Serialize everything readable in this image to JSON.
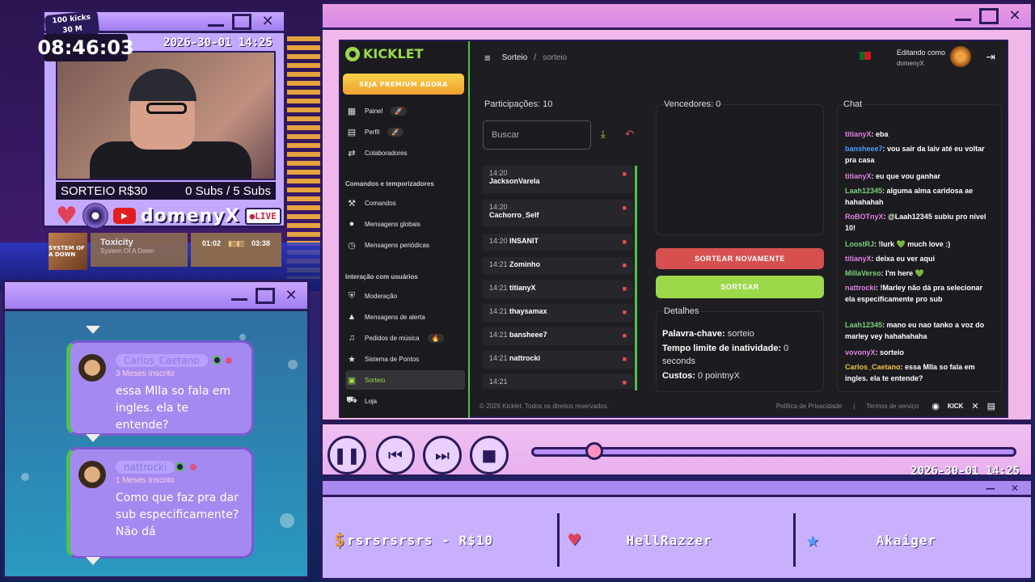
{
  "overlay": {
    "kicks_badge": "100 kicks\n30 M",
    "kicks_line1": "100 kicks",
    "kicks_line2": "30 M",
    "clock": "08:46:03",
    "date": "2026-30-01 14:25",
    "sorteio": "SORTEIO R$30",
    "subs": "0 Subs / 5 Subs",
    "channel": "domenyX",
    "live": "LIVE"
  },
  "music": {
    "album_text": "SYSTEM OF A DOWN",
    "title": "Toxicity",
    "artist": "System Of A Down",
    "elapsed": "01:02",
    "total": "03:38"
  },
  "chat_overlay": [
    {
      "name": "Carlos_Caetano",
      "sub": "3 Meses Inscrito",
      "msg": "essa Mlla so fala em ingles. ela te entende?"
    },
    {
      "name": "nattrocki",
      "sub": "1 Meses Inscrito",
      "msg": "Como que faz pra dar sub especificamente? Não dá"
    }
  ],
  "app": {
    "logo": "KICKLET",
    "premium": "SEJA PREMIUM AGORA",
    "nav_top": [
      {
        "label": "Painel",
        "icon": "grid-icon",
        "pill": "🚀"
      },
      {
        "label": "Perfil",
        "icon": "profile-icon",
        "pill": "🚀"
      },
      {
        "label": "Colaboradores",
        "icon": "swap-icon",
        "pill": ""
      }
    ],
    "section1": "Comandos e temporizadores",
    "nav_cmds": [
      {
        "label": "Comandos",
        "icon": "wrench-icon"
      },
      {
        "label": "Mensagens globais",
        "icon": "chat-icon"
      },
      {
        "label": "Mensagens periódicas",
        "icon": "clock-icon"
      }
    ],
    "section2": "Interação com usuários",
    "nav_users": [
      {
        "label": "Moderação",
        "icon": "shield-icon",
        "pill": ""
      },
      {
        "label": "Mensagens de alerta",
        "icon": "alert-icon",
        "pill": ""
      },
      {
        "label": "Pedidos de música",
        "icon": "music-icon",
        "pill": "🔥"
      },
      {
        "label": "Sistema de Pontos",
        "icon": "star-icon",
        "pill": ""
      },
      {
        "label": "Sorteio",
        "icon": "gift-icon",
        "pill": ""
      },
      {
        "label": "Loja",
        "icon": "cart-icon",
        "pill": ""
      }
    ],
    "breadcrumb": {
      "root": "Sorteio",
      "sep": "/",
      "current": "sorteio"
    },
    "editing_label": "Editando como",
    "editing_user": "domenyX",
    "participants_title": "Participações: 10",
    "search_placeholder": "Buscar",
    "participants": [
      {
        "time": "14:20",
        "name": "JacksonVarela",
        "stacked": true
      },
      {
        "time": "14:20",
        "name": "Cachorro_Self",
        "stacked": true
      },
      {
        "time": "14:20",
        "name": "INSANIT",
        "stacked": false
      },
      {
        "time": "14:21",
        "name": "Zominho",
        "stacked": false
      },
      {
        "time": "14:21",
        "name": "titianyX",
        "stacked": false
      },
      {
        "time": "14:21",
        "name": "thaysamax",
        "stacked": false
      },
      {
        "time": "14:21",
        "name": "bansheee7",
        "stacked": false
      },
      {
        "time": "14:21",
        "name": "nattrocki",
        "stacked": false
      },
      {
        "time": "14:21",
        "name": "",
        "stacked": false
      }
    ],
    "winners_title": "Vencedores: 0",
    "btn_redraw": "SORTEAR NOVAMENTE",
    "btn_draw": "SORTEAR",
    "details_title": "Detalhes",
    "details": [
      {
        "k": "Palavra-chave:",
        "v": " sorteio"
      },
      {
        "k": "Tempo limite de inatividade:",
        "v": " 0 seconds"
      },
      {
        "k": "Custos:",
        "v": " 0 pointnyX"
      }
    ],
    "chat_title": "Chat",
    "chat": [
      {
        "user": "titianyX",
        "color": "#e080e0",
        "text": "eba"
      },
      {
        "user": "bansheee7",
        "color": "#4aa0ff",
        "text": "vou sair da laiv até eu voltar pra casa"
      },
      {
        "user": "titianyX",
        "color": "#e080e0",
        "text": "eu que vou ganhar"
      },
      {
        "user": "Laah12345",
        "color": "#7ad07a",
        "text": "alguma alma caridosa ae hahahahah"
      },
      {
        "user": "RoBOTnyX",
        "color": "#e080e0",
        "text": "@Laah12345 subiu pro nível 10!"
      },
      {
        "user": "LoostRJ",
        "color": "#7ad07a",
        "text": "!lurk 💚 much love :)"
      },
      {
        "user": "titianyX",
        "color": "#e080e0",
        "text": "deixa eu ver aqui"
      },
      {
        "user": "MillaVerso",
        "color": "#7ad07a",
        "text": "I'm here 💚"
      },
      {
        "user": "nattrocki",
        "color": "#e080e0",
        "text": "!Marley não dá pra selecionar ela especificamente pro sub"
      },
      {
        "user": "Laah12345",
        "color": "#7ad07a",
        "text": "mano eu nao tanko a voz do marley vey hahahahaha"
      },
      {
        "user": "vovonyX",
        "color": "#e080e0",
        "text": "sorteio"
      },
      {
        "user": "Carlos_Caetano",
        "color": "#f0c040",
        "text": "essa Mlla so fala em ingles. ela te entende?"
      }
    ],
    "footer_copy": "© 2026 Kicklet. Todos os direitos reservados.",
    "footer_privacy": "Política de Privacidade",
    "footer_sep": "|",
    "footer_terms": "Termos de serviço",
    "footer_kick": "KICK"
  },
  "player": {
    "date": "2026-30-01 14:25",
    "progress": 0.13
  },
  "bottom": {
    "tip": "rsrsrsrsrs - R$10",
    "follower": "HellRazzer",
    "sub": "Akaiger"
  }
}
